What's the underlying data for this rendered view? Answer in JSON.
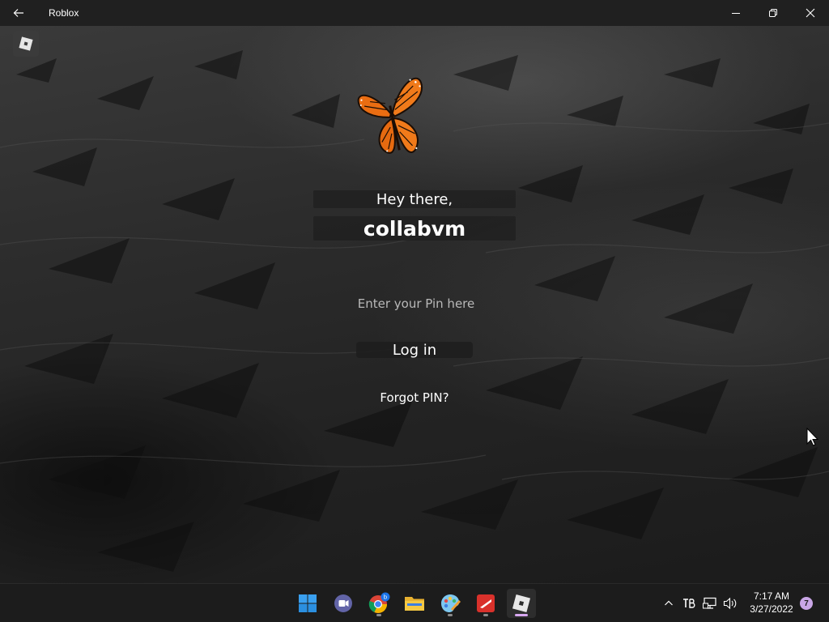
{
  "window": {
    "title": "Roblox",
    "back_icon": "back-arrow-icon",
    "controls": [
      "minimize-icon",
      "restore-icon",
      "close-icon"
    ]
  },
  "login": {
    "greeting": "Hey there,",
    "username": "collabvm",
    "pin_placeholder": "Enter your Pin here",
    "pin_value": "",
    "login_label": "Log in",
    "forgot_label": "Forgot PIN?"
  },
  "taskbar": {
    "apps": [
      {
        "name": "start-button",
        "icon": "windows-icon"
      },
      {
        "name": "teams-chat",
        "icon": "chat-icon"
      },
      {
        "name": "chrome",
        "icon": "chrome-icon",
        "badge": "b"
      },
      {
        "name": "file-explorer",
        "icon": "folder-icon"
      },
      {
        "name": "paint",
        "icon": "paint-icon"
      },
      {
        "name": "roblox-studio",
        "icon": "roblox-studio-icon"
      },
      {
        "name": "roblox",
        "icon": "roblox-icon",
        "active": true
      }
    ],
    "tray": [
      "chevron-up-icon",
      "tb-icon",
      "network-icon",
      "volume-icon"
    ],
    "time": "7:17 AM",
    "date": "3/27/2022",
    "notifications": "7"
  },
  "colors": {
    "titlebar": "#202020",
    "taskbar": "#1c1c1c",
    "butterfly": "#f07a1a",
    "accent_indicator": "#d8a7f0"
  }
}
